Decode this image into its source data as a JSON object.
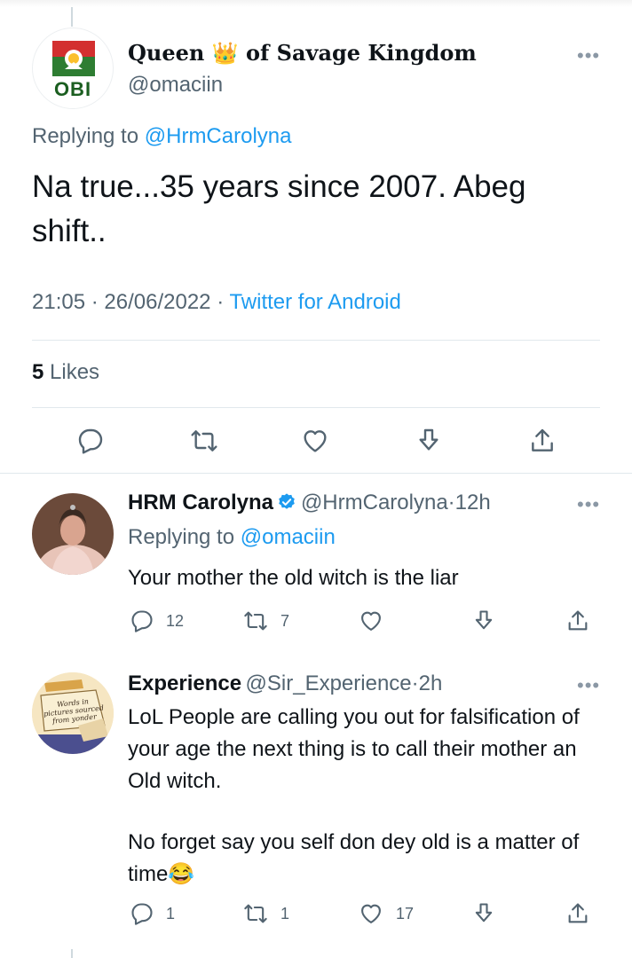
{
  "main_tweet": {
    "display_name": "Queen 👑 of Savage Kingdom",
    "handle": "@omaciin",
    "avatar_text": "OBI",
    "replying_prefix": "Replying to ",
    "replying_to": "@HrmCarolyna",
    "text": "Na true...35 years since 2007. Abeg shift..",
    "time": "21:05",
    "date": "26/06/2022",
    "separator": "·",
    "source": "Twitter for Android",
    "likes_count": "5",
    "likes_label": "Likes",
    "actions": [
      "reply-icon",
      "retweet-icon",
      "like-icon",
      "bookmark-icon",
      "share-icon"
    ]
  },
  "replies": [
    {
      "display_name": "HRM Carolyna",
      "verified": true,
      "handle": "@HrmCarolyna",
      "separator": "·",
      "age": "12h",
      "replying_prefix": "Replying to ",
      "replying_to": "@omaciin",
      "text": "Your mother the old witch is the liar",
      "reply_count": "12",
      "retweet_count": "7",
      "like_count": ""
    },
    {
      "display_name": "Experience",
      "handle": "@Sir_Experience",
      "separator": "·",
      "age": "2h",
      "avatar_lines": [
        "Words in",
        "pictures sourced",
        "from yonder"
      ],
      "text_p1": "LoL People are calling you out for falsification of your age the next thing is to call their mother an Old witch.",
      "text_p2": "No forget say you self don dey old is a matter of time😂",
      "reply_count": "1",
      "retweet_count": "1",
      "like_count": "17"
    }
  ],
  "colors": {
    "accent": "#1d9bf0",
    "text": "#0f1419",
    "secondary": "#536471",
    "divider": "#e1e8ed"
  }
}
